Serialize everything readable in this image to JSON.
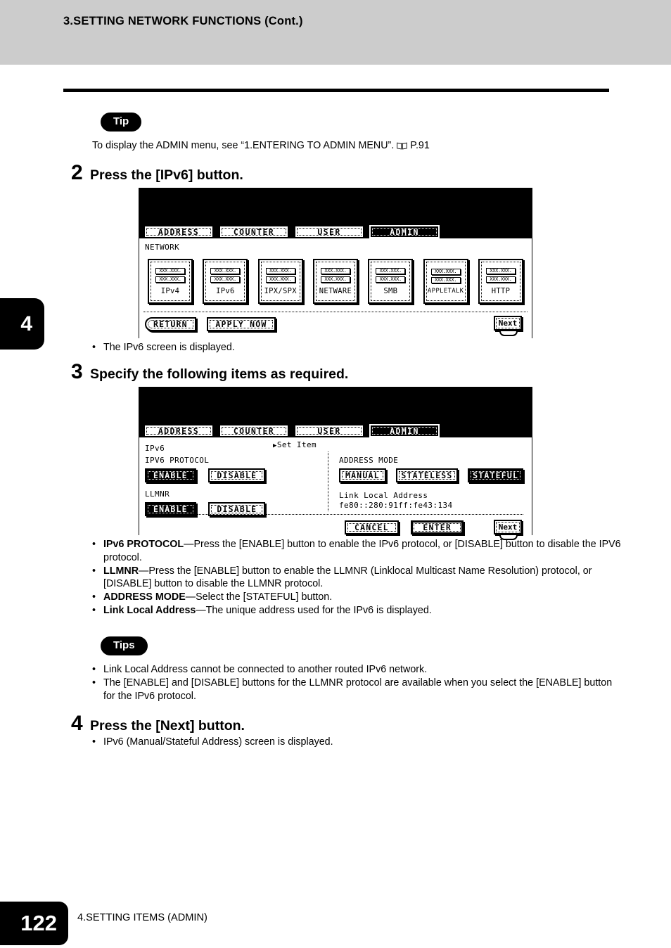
{
  "header": {
    "title": "3.SETTING NETWORK FUNCTIONS (Cont.)"
  },
  "tip_top": {
    "badge": "Tip",
    "text_before": "To display the ADMIN menu, see “1.ENTERING TO ADMIN MENU”.",
    "ref_icon": "book-icon",
    "ref": "P.91"
  },
  "chapter_tab": {
    "number": "4"
  },
  "steps": [
    {
      "number": "2",
      "title": "Press the [IPv6] button."
    },
    {
      "number": "3",
      "title": "Specify the following items as required."
    },
    {
      "number": "4",
      "title": "Press the [Next] button."
    }
  ],
  "step2_note": {
    "dot": "•",
    "text": "The IPv6 screen is displayed."
  },
  "screen1": {
    "tabs": [
      {
        "label": "ADDRESS",
        "active": false
      },
      {
        "label": "COUNTER",
        "active": false
      },
      {
        "label": "USER",
        "active": false
      },
      {
        "label": "ADMIN",
        "active": true
      }
    ],
    "title": "NETWORK",
    "icon_line1": "XXX.XXX.",
    "icon_line2": "XXX.XXX.",
    "buttons": [
      {
        "label": "IPv4"
      },
      {
        "label": "IPv6"
      },
      {
        "label": "IPX/SPX"
      },
      {
        "label": "NETWARE"
      },
      {
        "label": "SMB"
      },
      {
        "label": "APPLETALK"
      },
      {
        "label": "HTTP"
      }
    ],
    "footer_buttons": [
      {
        "label": "RETURN"
      },
      {
        "label": "APPLY NOW"
      }
    ],
    "next_label": "Next"
  },
  "screen2": {
    "tabs": [
      {
        "label": "ADDRESS",
        "active": false
      },
      {
        "label": "COUNTER",
        "active": false
      },
      {
        "label": "USER",
        "active": false
      },
      {
        "label": "ADMIN",
        "active": true
      }
    ],
    "title": "IPv6",
    "set_item": "Set Item",
    "set_item_arrow": "▶",
    "protocol_label": "IPV6 PROTOCOL",
    "protocol_enable": "ENABLE",
    "protocol_disable": "DISABLE",
    "llmnr_label": "LLMNR",
    "llmnr_enable": "ENABLE",
    "llmnr_disable": "DISABLE",
    "address_mode_label": "ADDRESS MODE",
    "address_mode_manual": "MANUAL",
    "address_mode_stateless": "STATELESS",
    "address_mode_stateful": "STATEFUL",
    "link_local_label": "Link Local Address",
    "link_local_value": "fe80::280:91ff:fe43:134",
    "cancel_label": "CANCEL",
    "enter_label": "ENTER",
    "next_label": "Next"
  },
  "step3_bullets": [
    {
      "dot": "•",
      "bold": "IPv6 PROTOCOL",
      "text": "—Press the [ENABLE] button to enable the IPv6 protocol, or [DISABLE] button to disable the IPV6 protocol."
    },
    {
      "dot": "•",
      "bold": "LLMNR",
      "text": "—Press the [ENABLE] button to enable the LLMNR (Linklocal Multicast Name Resolution) protocol, or [DISABLE] button to disable the LLMNR protocol."
    },
    {
      "dot": "•",
      "bold": "ADDRESS MODE",
      "text": "—Select the [STATEFUL] button."
    },
    {
      "dot": "•",
      "bold": "Link Local Address",
      "text": "—The unique address used for the IPv6 is displayed."
    }
  ],
  "tips_block": {
    "badge": "Tips",
    "items": [
      {
        "dot": "•",
        "text": "Link Local Address cannot be connected to another routed IPv6 network."
      },
      {
        "dot": "•",
        "text": "The [ENABLE] and [DISABLE] buttons for the LLMNR protocol are available when you select the [ENABLE] button for the IPv6 protocol."
      }
    ]
  },
  "step4_note": {
    "dot": "•",
    "text": "IPv6 (Manual/Stateful Address) screen is displayed."
  },
  "footer": {
    "page_number": "122",
    "section": "4.SETTING ITEMS (ADMIN)"
  },
  "colors": {
    "header_band": "#cccccc",
    "ink": "#000000",
    "paper": "#ffffff"
  }
}
